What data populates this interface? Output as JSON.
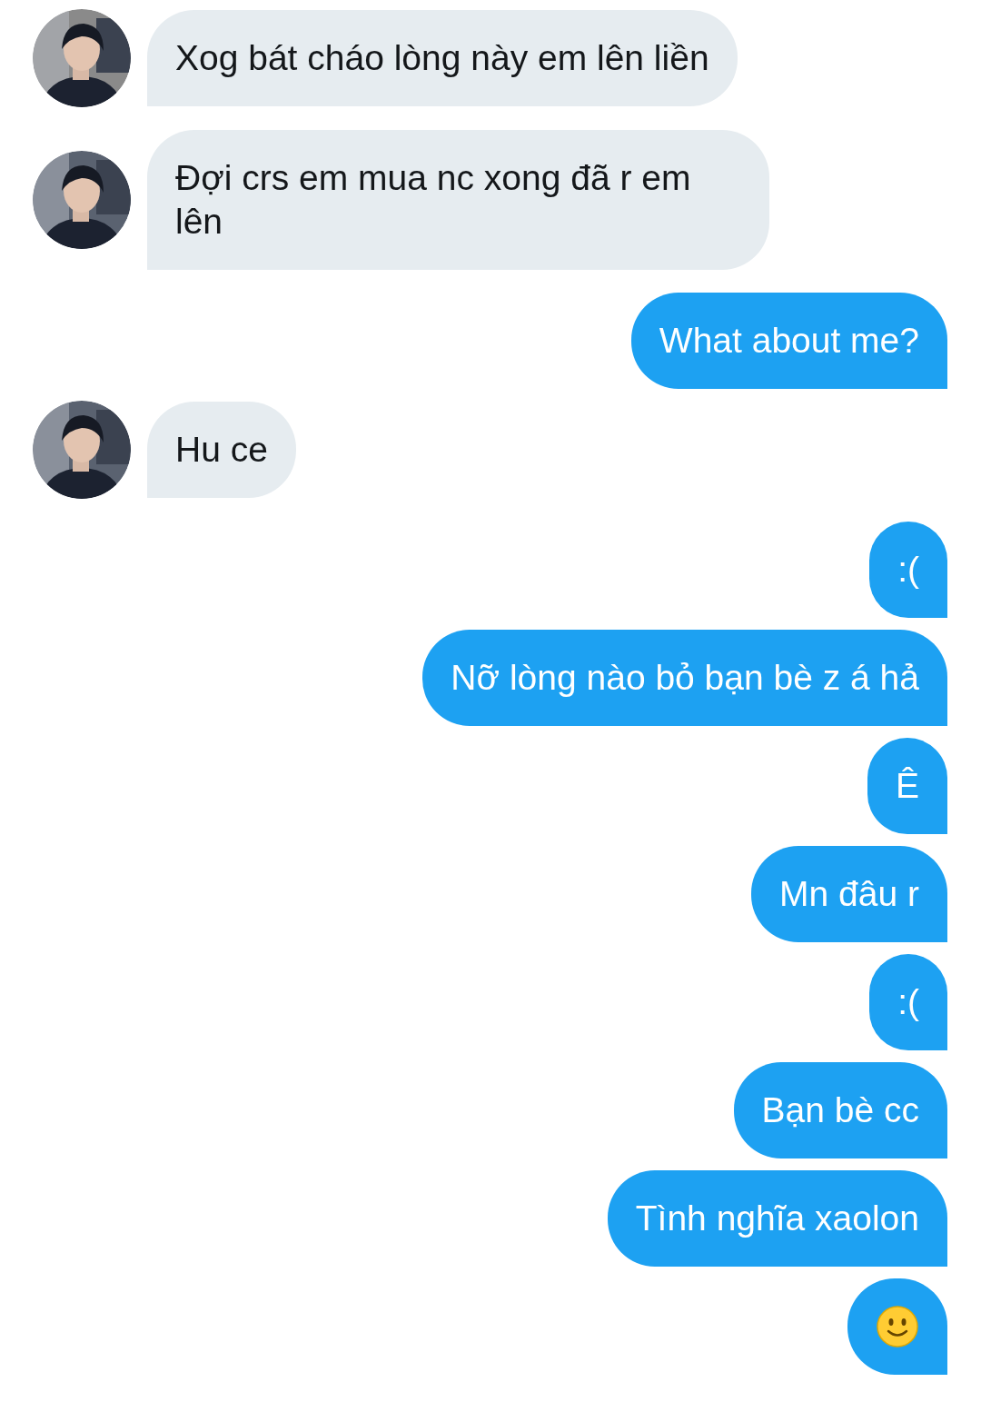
{
  "messages": [
    {
      "outgoing": false,
      "kind": "text",
      "text": "Xog bát cháo lòng này em lên liền"
    },
    {
      "outgoing": false,
      "kind": "text",
      "text": "Đợi crs em mua nc xong đã r em lên"
    },
    {
      "outgoing": true,
      "kind": "text",
      "text": "What about me?"
    },
    {
      "outgoing": false,
      "kind": "text",
      "text": "Hu ce"
    },
    {
      "outgoing": true,
      "kind": "text",
      "text": ":("
    },
    {
      "outgoing": true,
      "kind": "text",
      "text": "Nỡ lòng nào bỏ bạn bè z á hả"
    },
    {
      "outgoing": true,
      "kind": "text",
      "text": "Ê"
    },
    {
      "outgoing": true,
      "kind": "text",
      "text": "Mn đâu r"
    },
    {
      "outgoing": true,
      "kind": "text",
      "text": ":("
    },
    {
      "outgoing": true,
      "kind": "text",
      "text": "Bạn bè cc"
    },
    {
      "outgoing": true,
      "kind": "text",
      "text": "Tình nghĩa xaolon"
    },
    {
      "outgoing": true,
      "kind": "emoji"
    }
  ]
}
